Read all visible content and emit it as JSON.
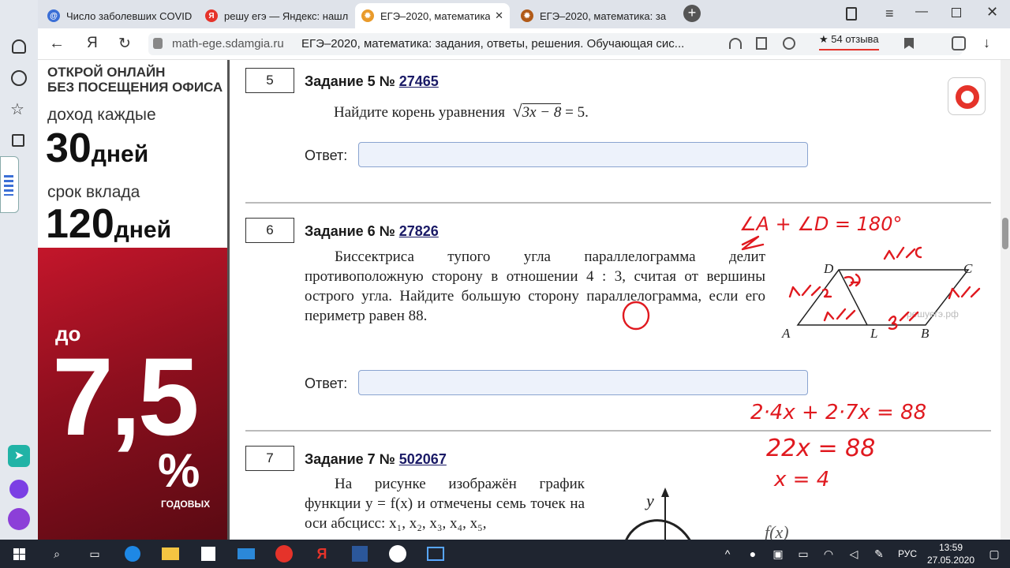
{
  "tabs": [
    {
      "title": "Число заболевших COVID"
    },
    {
      "title": "решу егэ — Яндекс: нашл"
    },
    {
      "title": "ЕГЭ–2020, математика: з"
    },
    {
      "title": "ЕГЭ–2020, математика: за"
    }
  ],
  "address": {
    "domain": "math-ege.sdamgia.ru",
    "title": "ЕГЭ–2020, математика: задания, ответы, решения. Обучающая сис...",
    "reviews": "54 отзыва"
  },
  "ad": {
    "line1": "ОТКРОЙ ОНЛАЙН",
    "line2": "БЕЗ ПОСЕЩЕНИЯ ОФИСА",
    "income": "доход каждые",
    "days1": "30",
    "days_word": "дней",
    "term": "срок вклада",
    "days2": "120",
    "upto": "до",
    "rate": "7,5",
    "percent": "%",
    "annual": "ГОДОВЫХ"
  },
  "tasks": [
    {
      "num": "5",
      "title": "Задание 5 №",
      "id": "27465",
      "text": "Найдите корень уравнения",
      "answer_label": "Ответ:"
    },
    {
      "num": "6",
      "title": "Задание 6 №",
      "id": "27826",
      "text": "Биссектриса тупого угла параллелограмма делит противоположную сторону в отношении 4 : 3, считая от вершины острого угла. Найдите большую сторону параллелограмма, если его периметр равен 88.",
      "answer_label": "Ответ:",
      "watermark": "решуегэ.рф"
    },
    {
      "num": "7",
      "title": "Задание 7 №",
      "id": "502067",
      "text": "На рисунке изображён график функции y = f(x) и отмечены семь точек на оси абсцисс: x₁, x₂, x₃, x₄, x₅,"
    }
  ],
  "equation": {
    "radicand": "3x − 8",
    "rhs": "= 5."
  },
  "diagram": {
    "A": "A",
    "B": "B",
    "C": "C",
    "D": "D",
    "L": "L"
  },
  "handwriting": {
    "h1": "∠A + ∠D = 180°",
    "h2": "2·4x + 2·7x = 88",
    "h3": "22x = 88",
    "h4": "x = 4"
  },
  "graph": {
    "y": "y",
    "f": "f(x)"
  },
  "taskbar": {
    "lang": "РУС",
    "time": "13:59",
    "date": "27.05.2020"
  }
}
